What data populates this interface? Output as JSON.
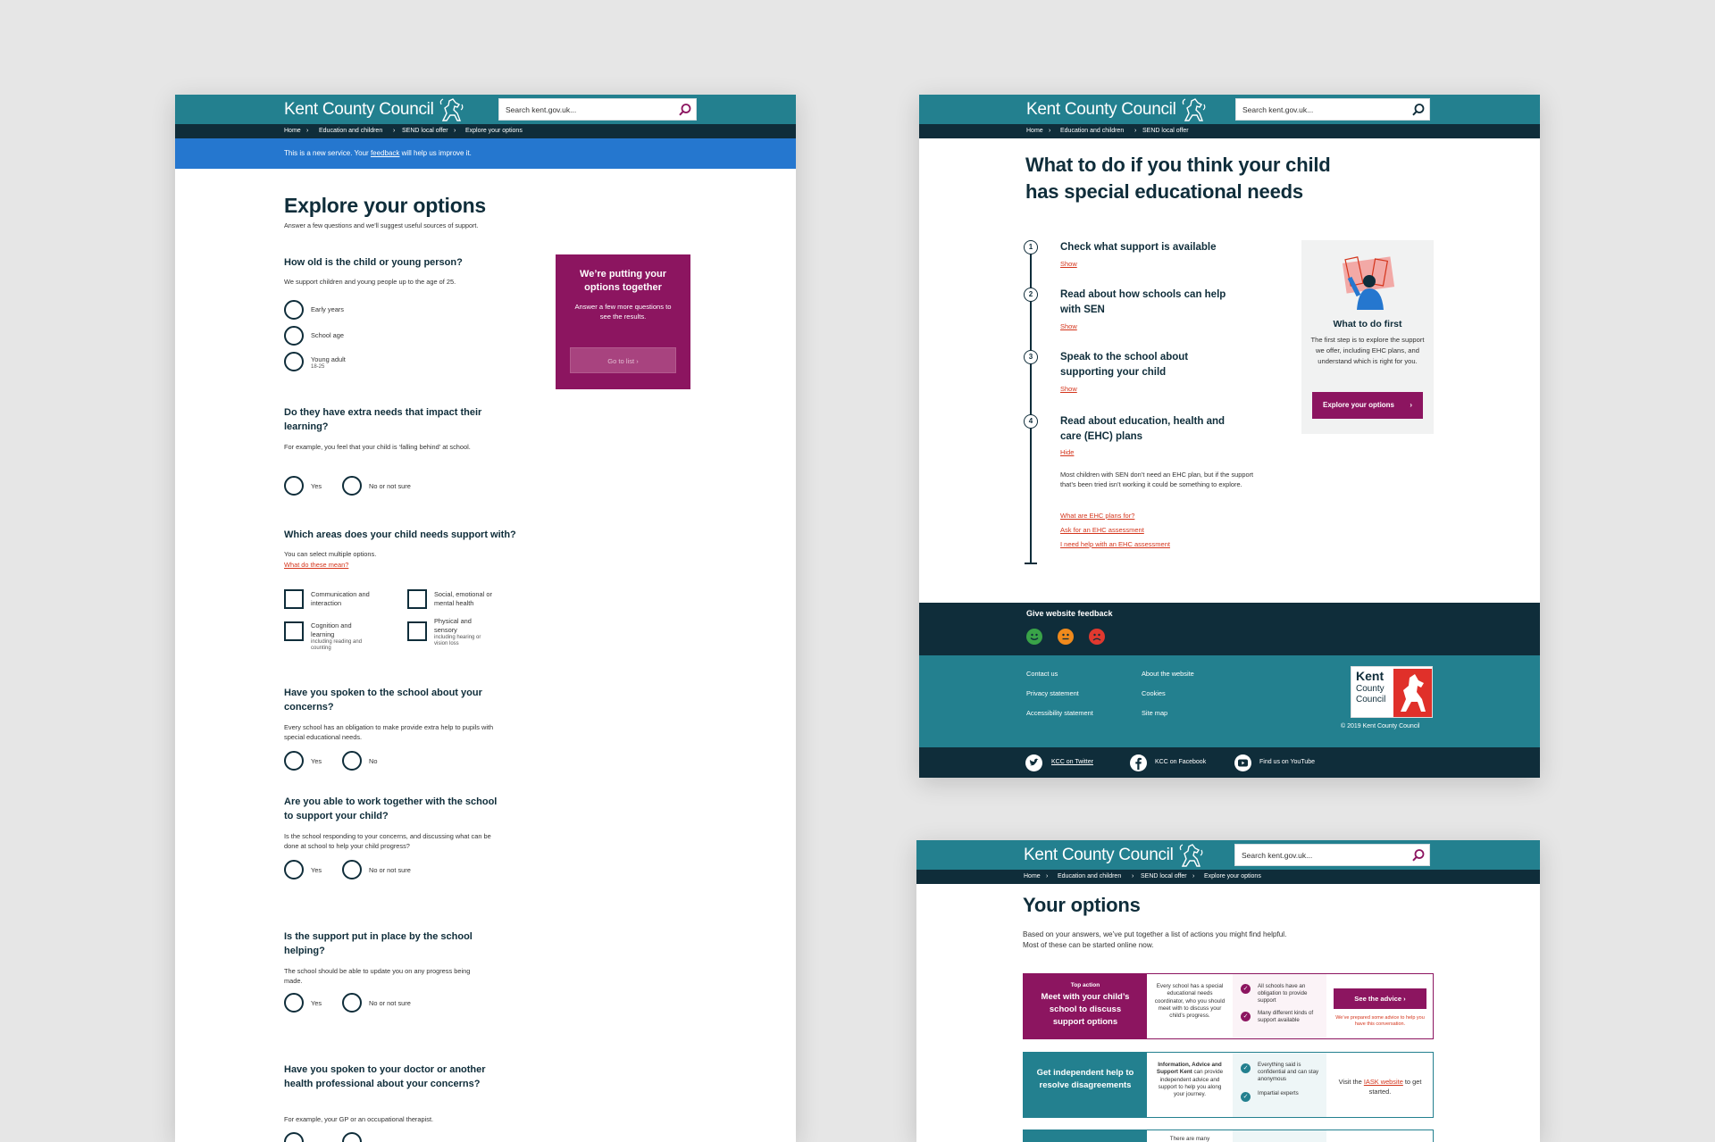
{
  "brand": {
    "name": "Kent County Council"
  },
  "search": {
    "placeholder": "Search kent.gov.uk..."
  },
  "crumb_labels": {
    "home": "Home",
    "education": "Education and children",
    "send": "SEND local offer",
    "explore": "Explore your options"
  },
  "colors": {
    "teal": "#23808f",
    "navy": "#0f2d3a",
    "magenta": "#8c1560",
    "banner_blue": "#2577cf",
    "link_red": "#d4351c"
  },
  "explore": {
    "banner_text": "This is a new service. Your",
    "banner_link": "feedback",
    "banner_after": "will help us improve it.",
    "title": "Explore your options",
    "intro": "Answer a few questions and we’ll suggest useful sources of support.",
    "q1": {
      "title": "How old is the child or young person?",
      "hint": "We support children and young people up to the age of 25.",
      "o1": "Early years",
      "o2": "School age",
      "o3": "Young adult",
      "o3_sub": "18-25"
    },
    "q2": {
      "title": "Do they have extra needs that impact their learning?",
      "hint": "For example, you feel that your child is ‘falling behind’ at school.",
      "o1": "Yes",
      "o2": "No or not sure"
    },
    "q3": {
      "title": "Which areas does your child needs support with?",
      "hint": "You can select multiple options.",
      "link": "What do these mean?",
      "o1": "Communication and interaction",
      "o2": "Social, emotional or mental health",
      "o3": "Cognition and learning",
      "o3_sub": "including reading and counting",
      "o4": "Physical and sensory",
      "o4_sub": "including hearing or vision loss"
    },
    "q4": {
      "title": "Have you spoken to the school about your concerns?",
      "hint": "Every school has an obligation to make provide extra help to pupils with special educational needs.",
      "o1": "Yes",
      "o2": "No"
    },
    "q5": {
      "title": "Are you able to work together with the school to support your child?",
      "hint": "Is the school responding to your concerns, and discussing what can be done at school to help your child progress?",
      "o1": "Yes",
      "o2": "No or not sure"
    },
    "q6": {
      "title": "Is the support put in place by the school helping?",
      "hint": "The school should be able to update you on any progress being made.",
      "o1": "Yes",
      "o2": "No or not sure"
    },
    "q7": {
      "title": "Have you spoken to your doctor or another health professional about your concerns?",
      "hint": "For example, your GP or an occupational therapist."
    },
    "card": {
      "title": "We’re putting your options together",
      "body": "Answer a few more questions to see the results.",
      "button": "Go to list"
    }
  },
  "what_to_do": {
    "title": "What to do if you think your child has special educational needs",
    "steps": [
      {
        "num": "1",
        "title": "Check what support is available",
        "toggle": "Show"
      },
      {
        "num": "2",
        "title": "Read about how schools can help with SEN",
        "toggle": "Show"
      },
      {
        "num": "3",
        "title": "Speak to the school about supporting your child",
        "toggle": "Show"
      },
      {
        "num": "4",
        "title": "Read about education, health and care (EHC) plans",
        "toggle": "Hide"
      }
    ],
    "step4_body": "Most children with SEN don’t need an EHC plan, but if the support that’s been tried isn’t working it could be something to explore.",
    "step4_links": [
      "What are EHC plans for?",
      "Ask for an EHC assessment",
      "I need help with an EHC assessment"
    ],
    "side": {
      "title": "What to do first",
      "body": "The first step is to explore the support we offer, including EHC plans, and understand which is right for you.",
      "button": "Explore your options"
    },
    "feedback": {
      "title": "Give website feedback"
    },
    "footer": {
      "col1": [
        "Contact us",
        "Privacy statement",
        "Accessibility statement"
      ],
      "col2": [
        "About the website",
        "Cookies",
        "Site map"
      ],
      "logo": [
        "Kent",
        "County",
        "Council"
      ],
      "copyright": "© 2019 Kent County Council"
    },
    "social": {
      "twitter": "KCC on Twitter",
      "facebook": "KCC on Facebook",
      "youtube": "Find us on YouTube"
    }
  },
  "your_options": {
    "title": "Your options",
    "intro": "Based on your answers, we’ve put together a list of actions you might find helpful. Most of these can be started online now.",
    "row1": {
      "kicker": "Top action",
      "label": "Meet with your child’s school to discuss support options",
      "desc": "Every school has a special educational needs coordinator, who you should meet with to discuss your child’s progress.",
      "b1": "All schools have an obligation to provide support",
      "b2": "Many different kinds of support available",
      "button": "See the advice",
      "note": "We’ve prepared some advice to help you have this conversation."
    },
    "row2": {
      "label": "Get independent help to resolve disagreements",
      "desc_bold": "Information, Advice and Support Kent",
      "desc": "can provide independent advice and support to help you along your journey.",
      "b1": "Everything said is confidential and can stay anonymous",
      "b2": "Impartial experts",
      "visit": "Visit the",
      "visit_link": "IASK website",
      "visit_after": "to get started."
    },
    "row3": {
      "desc": "There are many"
    }
  }
}
